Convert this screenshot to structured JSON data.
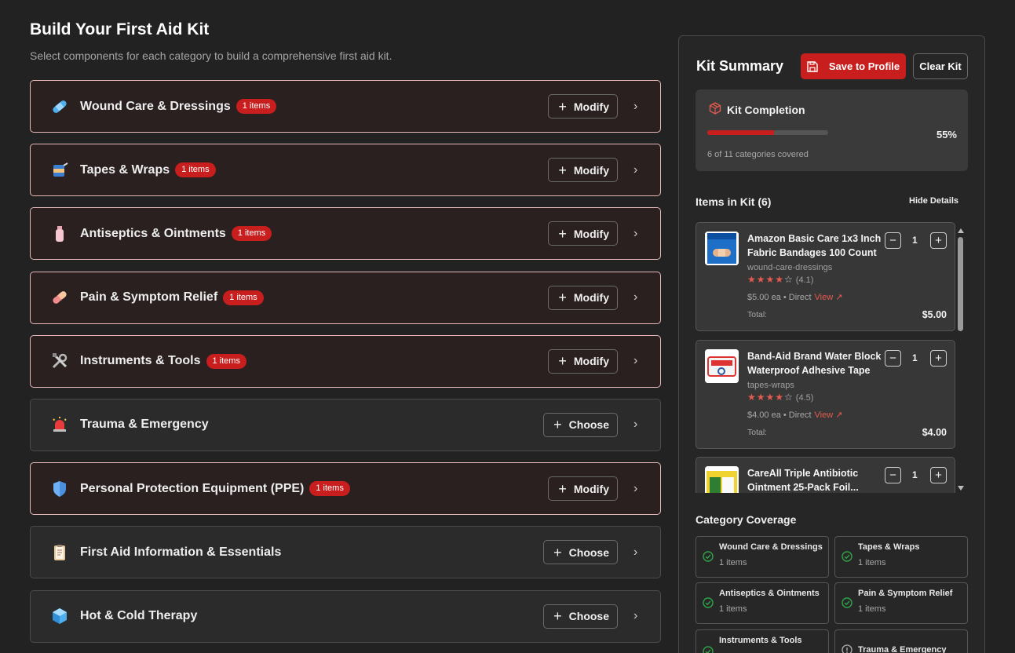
{
  "page": {
    "title": "Build Your First Aid Kit",
    "subtitle": "Select components for each category to build a comprehensive first aid kit."
  },
  "categories": [
    {
      "name": "Wound Care & Dressings",
      "badge": "1 items",
      "action": "Modify",
      "selected": true,
      "icon": "bandage-icon"
    },
    {
      "name": "Tapes & Wraps",
      "badge": "1 items",
      "action": "Modify",
      "selected": true,
      "icon": "tape-spool-icon"
    },
    {
      "name": "Antiseptics & Ointments",
      "badge": "1 items",
      "action": "Modify",
      "selected": true,
      "icon": "lotion-bottle-icon"
    },
    {
      "name": "Pain & Symptom Relief",
      "badge": "1 items",
      "action": "Modify",
      "selected": true,
      "icon": "pill-icon"
    },
    {
      "name": "Instruments & Tools",
      "badge": "1 items",
      "action": "Modify",
      "selected": true,
      "icon": "tools-icon"
    },
    {
      "name": "Trauma & Emergency",
      "badge": "",
      "action": "Choose",
      "selected": false,
      "icon": "siren-icon"
    },
    {
      "name": "Personal Protection Equipment (PPE)",
      "badge": "1 items",
      "action": "Modify",
      "selected": true,
      "icon": "shield-icon"
    },
    {
      "name": "First Aid Information & Essentials",
      "badge": "",
      "action": "Choose",
      "selected": false,
      "icon": "clipboard-icon"
    },
    {
      "name": "Hot & Cold Therapy",
      "badge": "",
      "action": "Choose",
      "selected": false,
      "icon": "ice-cube-icon"
    }
  ],
  "summary": {
    "title": "Kit Summary",
    "save_label": "Save to Profile",
    "clear_label": "Clear Kit",
    "completion_title": "Kit Completion",
    "completion_percent": 55,
    "completion_label": "55%",
    "coverage_text": "6 of 11 categories covered",
    "items_title": "Items in Kit (6)",
    "hide_details_label": "Hide Details",
    "coverage_title": "Category Coverage",
    "accent_color": "#c81e1e"
  },
  "items": [
    {
      "title": "Amazon Basic Care 1x3 Inch Fabric Bandages 100 Count",
      "category": "wound-care-dressings",
      "stars": "★★★★",
      "empty_stars": "☆",
      "rating": "(4.1)",
      "price": "$5.00 ea • Direct",
      "view": "View ↗",
      "qty": "1",
      "total_label": "Total:",
      "total": "$5.00"
    },
    {
      "title": "Band-Aid Brand Water Block Waterproof Adhesive Tape",
      "category": "tapes-wraps",
      "stars": "★★★★",
      "empty_stars": "☆",
      "rating": "(4.5)",
      "price": "$4.00 ea • Direct",
      "view": "View ↗",
      "qty": "1",
      "total_label": "Total:",
      "total": "$4.00"
    },
    {
      "title": "CareAll Triple Antibiotic Ointment 25-Pack Foil...",
      "category": "",
      "stars": "",
      "empty_stars": "",
      "rating": "",
      "price": "",
      "view": "",
      "qty": "1",
      "total_label": "",
      "total": ""
    }
  ],
  "coverage": [
    {
      "name": "Wound Care & Dressings",
      "count": "1 items",
      "covered": true
    },
    {
      "name": "Tapes & Wraps",
      "count": "1 items",
      "covered": true
    },
    {
      "name": "Antiseptics & Ointments",
      "count": "1 items",
      "covered": true
    },
    {
      "name": "Pain & Symptom Relief",
      "count": "1 items",
      "covered": true
    },
    {
      "name": "Instruments & Tools",
      "count": "",
      "covered": true
    },
    {
      "name": "Trauma & Emergency",
      "count": "",
      "covered": false
    }
  ]
}
